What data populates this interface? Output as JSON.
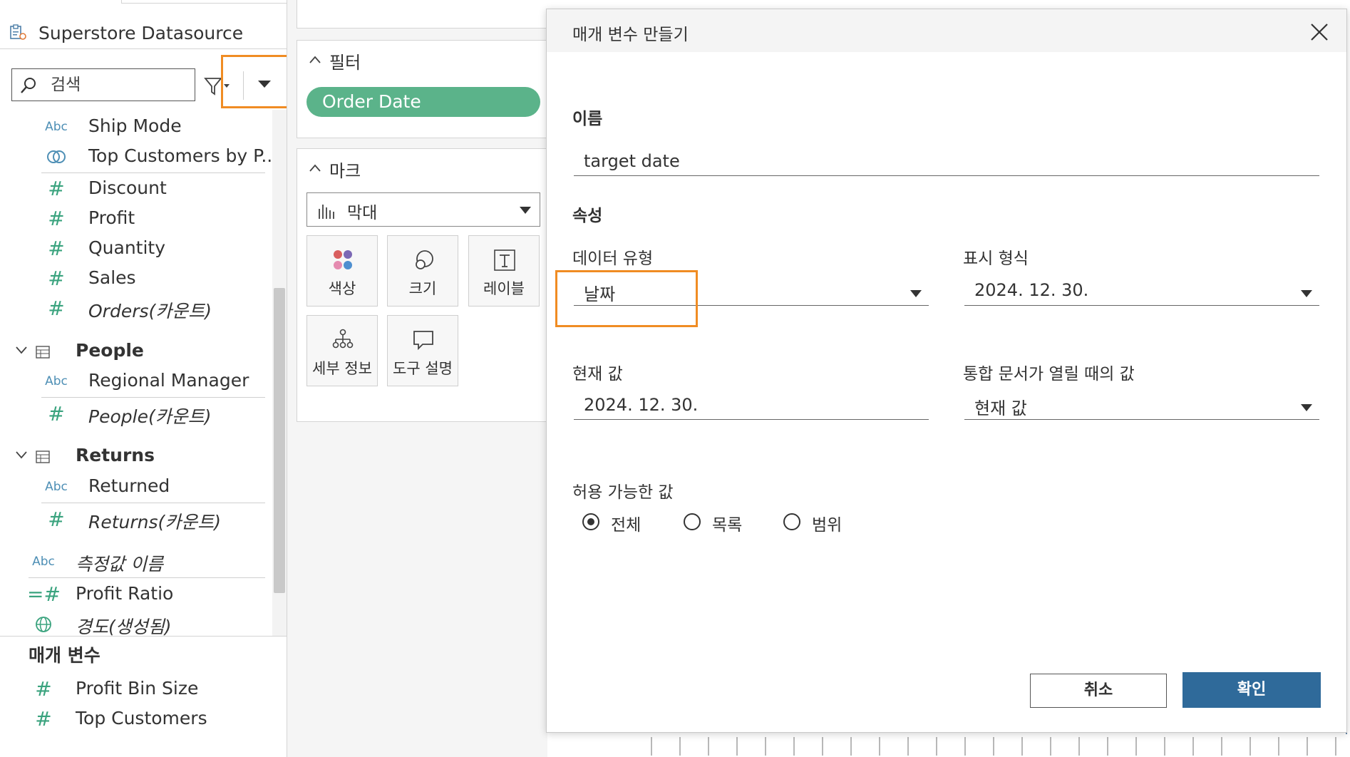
{
  "datasource": {
    "name": "Superstore Datasource"
  },
  "search": {
    "placeholder": "검색"
  },
  "fields": {
    "ship_mode": {
      "type": "Abc",
      "name": "Ship Mode"
    },
    "top_customers_set": {
      "name": "Top Customers by P..."
    },
    "discount": {
      "type": "#",
      "name": "Discount"
    },
    "profit": {
      "type": "#",
      "name": "Profit"
    },
    "quantity": {
      "type": "#",
      "name": "Quantity"
    },
    "sales": {
      "type": "#",
      "name": "Sales"
    },
    "orders_count": {
      "type": "#",
      "name": "Orders(카운트)"
    }
  },
  "groups": {
    "people": {
      "name": "People",
      "regional_manager": {
        "type": "Abc",
        "name": "Regional Manager"
      },
      "people_count": {
        "type": "#",
        "name": "People(카운트)"
      }
    },
    "returns": {
      "name": "Returns",
      "returned": {
        "type": "Abc",
        "name": "Returned"
      },
      "returns_count": {
        "type": "#",
        "name": "Returns(카운트)"
      }
    }
  },
  "extra_fields": {
    "measure_names": {
      "type": "Abc",
      "name": "측정값 이름"
    },
    "profit_ratio": {
      "type": "=#",
      "name": "Profit Ratio"
    },
    "longitude": {
      "name": "경도(생성됨)"
    }
  },
  "parameters": {
    "title": "매개 변수",
    "items": [
      {
        "type": "#",
        "name": "Profit Bin Size"
      },
      {
        "type": "#",
        "name": "Top Customers"
      }
    ]
  },
  "filters": {
    "title": "필터",
    "pill": "Order Date"
  },
  "marks": {
    "title": "마크",
    "type": "막대",
    "buttons": {
      "color": "색상",
      "size": "크기",
      "label": "레이블",
      "detail": "세부 정보",
      "tooltip": "도구 설명"
    }
  },
  "dialog": {
    "title": "매개 변수 만들기",
    "name_label": "이름",
    "name_value": "target date",
    "properties_label": "속성",
    "data_type_label": "데이터 유형",
    "data_type_value": "날짜",
    "display_format_label": "표시 형식",
    "display_format_value": "2024. 12. 30.",
    "current_value_label": "현재 값",
    "current_value_value": "2024. 12. 30.",
    "on_open_label": "통합 문서가 열릴 때의 값",
    "on_open_value": "현재 값",
    "allowable_label": "허용 가능한 값",
    "allowable_options": [
      "전체",
      "목록",
      "범위"
    ],
    "allowable_selected": "전체",
    "cancel": "취소",
    "ok": "확인"
  },
  "colors": {
    "highlight": "#f08c23",
    "pill": "#5bb38a",
    "ok_button": "#2f6a9a",
    "measure_icon": "#3aa37e",
    "dimension_icon": "#4e8fb5"
  }
}
